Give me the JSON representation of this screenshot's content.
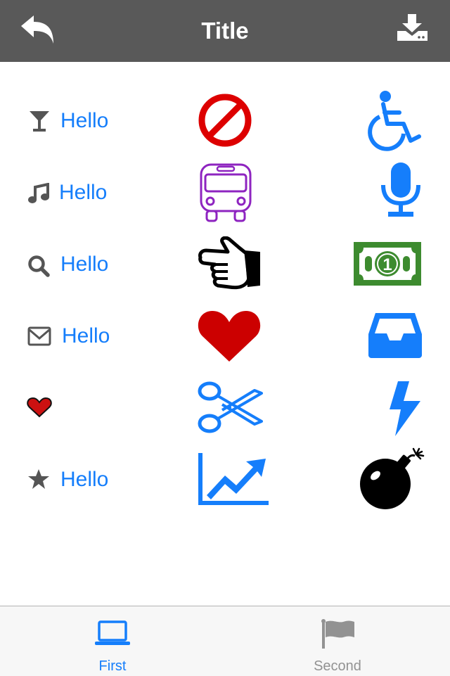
{
  "navbar": {
    "title": "Title",
    "back_icon": "reply-arrow-icon",
    "download_icon": "download-tray-icon"
  },
  "colors": {
    "navbar_bg": "#595959",
    "link_blue": "#157efb",
    "icon_gray": "#555555",
    "red": "#cc0000",
    "purple": "#8e24c0",
    "green": "#3d8b2f",
    "tab_active": "#157efb",
    "tab_inactive": "#929292"
  },
  "rows": [
    {
      "left_icon": "cocktail-glass-icon",
      "label": "Hello",
      "center_icon": "ban-icon",
      "right_icon": "wheelchair-icon"
    },
    {
      "left_icon": "music-note-icon",
      "label": "Hello",
      "center_icon": "bus-icon",
      "right_icon": "microphone-icon"
    },
    {
      "left_icon": "search-icon",
      "label": "Hello",
      "center_icon": "hand-pointing-left-icon",
      "right_icon": "money-bill-icon"
    },
    {
      "left_icon": "envelope-icon",
      "label": "Hello",
      "center_icon": "heart-icon",
      "right_icon": "inbox-tray-icon"
    },
    {
      "left_icon": "small-heart-icon",
      "label": "",
      "center_icon": "scissors-icon",
      "right_icon": "lightning-bolt-icon"
    },
    {
      "left_icon": "star-icon",
      "label": "Hello",
      "center_icon": "area-chart-icon",
      "right_icon": "bomb-icon"
    }
  ],
  "money_bill_text": "1",
  "tabbar": {
    "tabs": [
      {
        "label": "First",
        "icon": "laptop-icon",
        "active": true
      },
      {
        "label": "Second",
        "icon": "flag-icon",
        "active": false
      }
    ]
  }
}
